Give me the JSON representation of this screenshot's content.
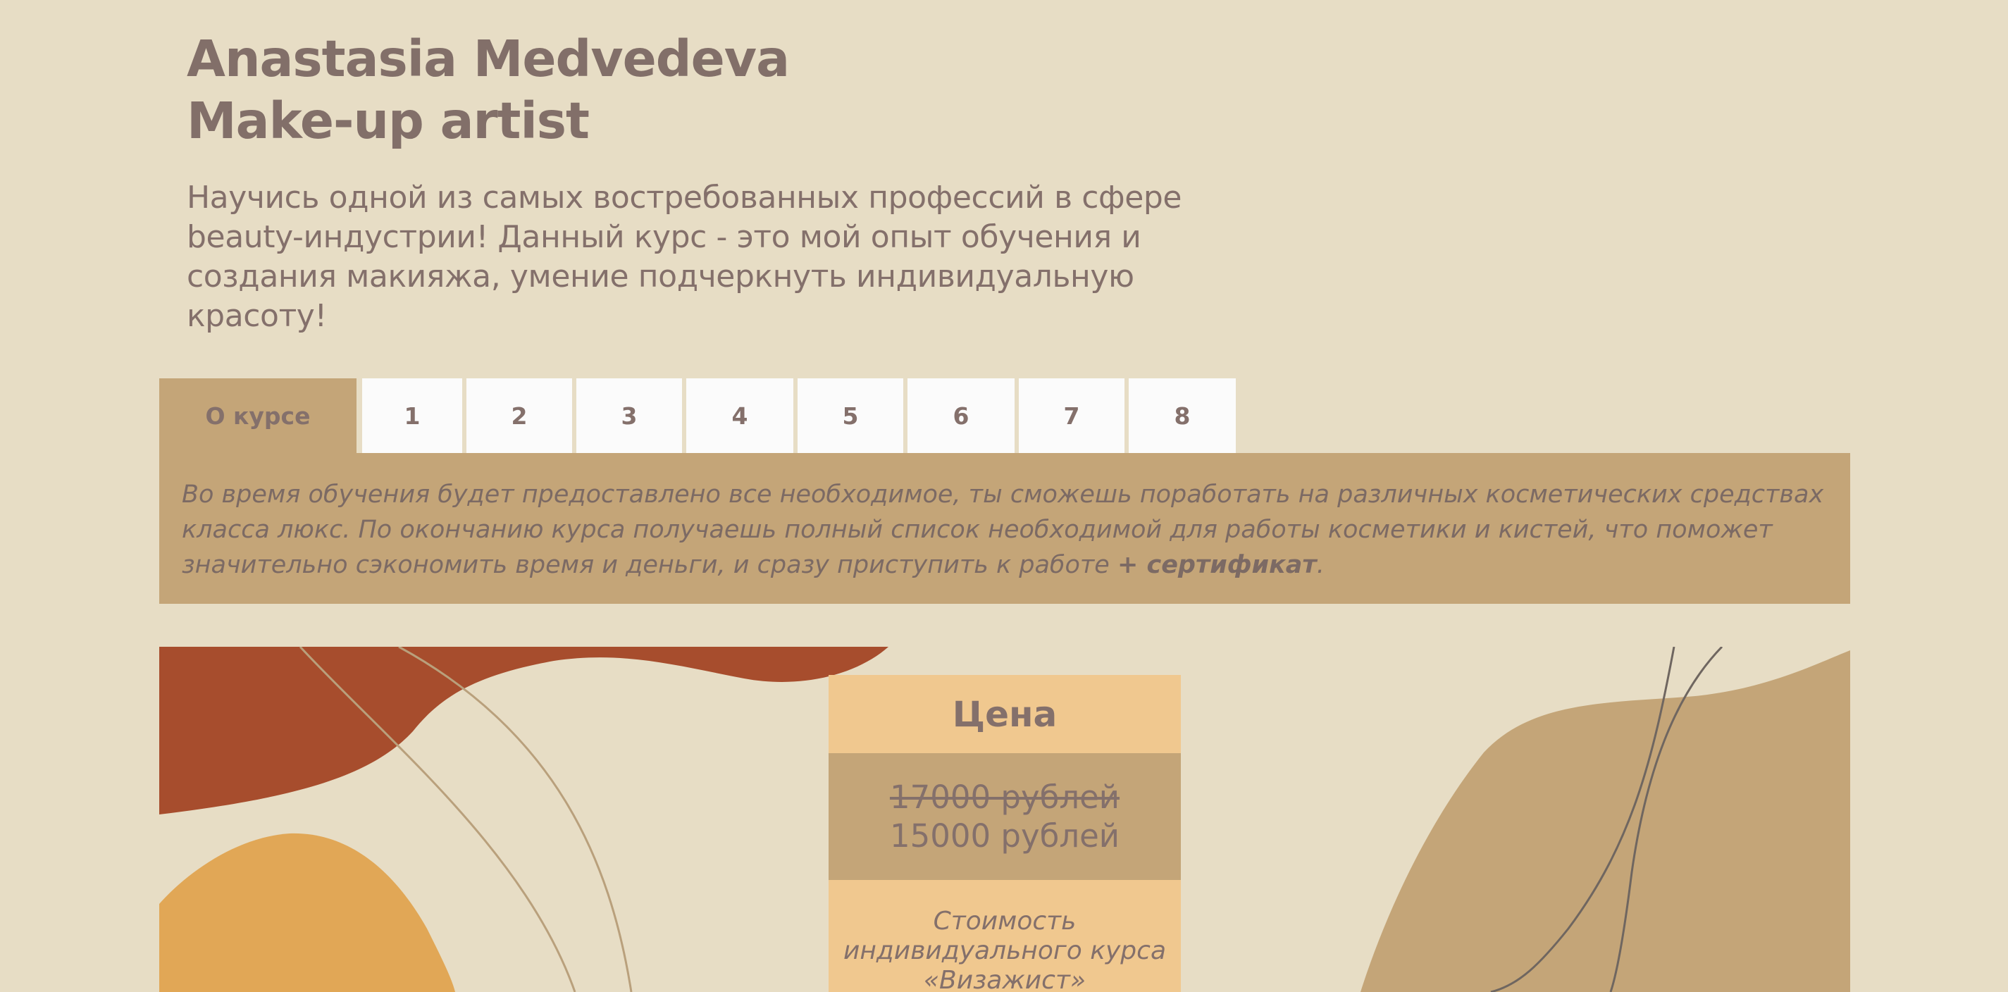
{
  "header": {
    "title_line1": "Anastasia Medvedeva",
    "title_line2": "Make-up artist",
    "intro": "Научись одной из самых востребованных профессий в сфере beauty-индустрии! Данный курс - это мой опыт обучения и создания макияжа, умение подчеркнуть индивидуальную красоту!"
  },
  "tabs": [
    {
      "label": "О курсе",
      "active": true
    },
    {
      "label": "1"
    },
    {
      "label": "2"
    },
    {
      "label": "3"
    },
    {
      "label": "4"
    },
    {
      "label": "5"
    },
    {
      "label": "6"
    },
    {
      "label": "7"
    },
    {
      "label": "8"
    }
  ],
  "about": {
    "text": "Во время обучения будет предоставлено все необходимое, ты сможешь поработать на различных косметических средствах класса люкс. По окончанию курса получаешь полный список необходимой для работы косметики и кистей, что поможет значительно сэкономить время и деньги, и сразу приступить к работе ",
    "highlight": "+ сертификат",
    "end": "."
  },
  "price": {
    "heading": "Цена",
    "old": "17000 рублей",
    "new": "15000 рублей",
    "note_line1": "Стоимость",
    "note_line2": "индивидуального курса",
    "note_line3": "«Визажист»"
  },
  "colors": {
    "background": "#e7ddc5",
    "tab_active": "#c4a578",
    "tab_inactive": "#fbfbfb",
    "price_head": "#f0c88f",
    "rust": "#a74d2d",
    "orange": "#e1a756",
    "tan": "#c4a578",
    "text": "#84706b"
  }
}
